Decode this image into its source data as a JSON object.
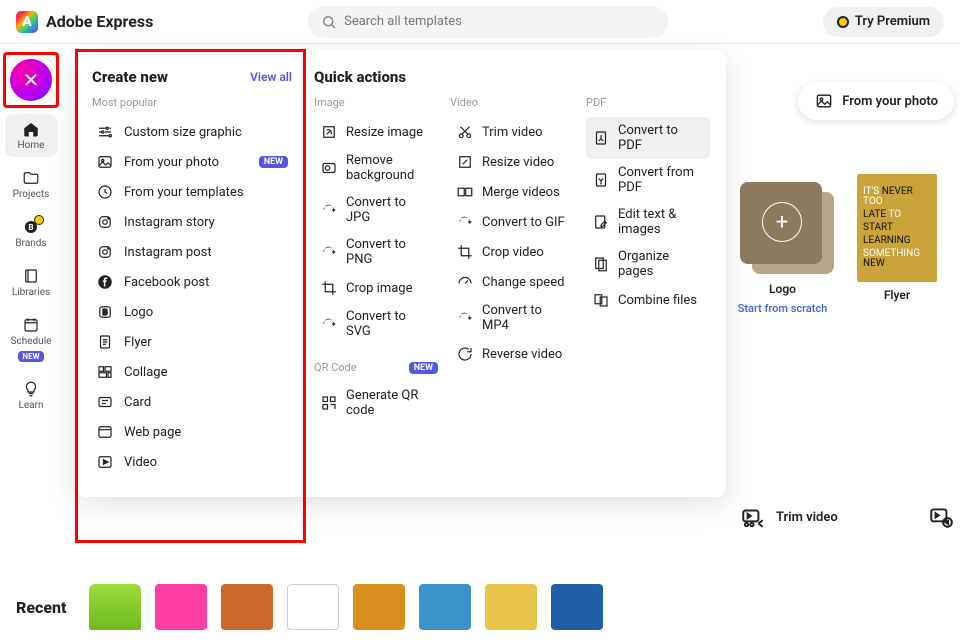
{
  "header": {
    "brand": "Adobe Express",
    "brand_glyph": "A",
    "search_placeholder": "Search all templates",
    "premium_label": "Try Premium"
  },
  "sidenav": {
    "items": [
      {
        "label": "Home",
        "icon": "home-icon"
      },
      {
        "label": "Projects",
        "icon": "folder-icon"
      },
      {
        "label": "Brands",
        "icon": "brand-icon"
      },
      {
        "label": "Libraries",
        "icon": "book-icon"
      },
      {
        "label": "Schedule",
        "icon": "calendar-icon",
        "badge": "NEW"
      },
      {
        "label": "Learn",
        "icon": "bulb-icon"
      }
    ]
  },
  "create_panel": {
    "title": "Create new",
    "view_all": "View all",
    "subhead": "Most popular",
    "items": [
      {
        "label": "Custom size graphic",
        "icon": "sliders-icon"
      },
      {
        "label": "From your photo",
        "icon": "photo-icon",
        "pill": "NEW"
      },
      {
        "label": "From your templates",
        "icon": "clock-icon"
      },
      {
        "label": "Instagram story",
        "icon": "instagram-icon"
      },
      {
        "label": "Instagram post",
        "icon": "instagram-icon"
      },
      {
        "label": "Facebook post",
        "icon": "facebook-icon"
      },
      {
        "label": "Logo",
        "icon": "bold-icon"
      },
      {
        "label": "Flyer",
        "icon": "page-icon"
      },
      {
        "label": "Collage",
        "icon": "collage-icon"
      },
      {
        "label": "Card",
        "icon": "card-icon"
      },
      {
        "label": "Web page",
        "icon": "browser-icon"
      },
      {
        "label": "Video",
        "icon": "play-icon"
      }
    ]
  },
  "quick_actions": {
    "title": "Quick actions",
    "columns": [
      {
        "head": "Image",
        "rows": [
          {
            "label": "Resize image",
            "icon": "resize-icon"
          },
          {
            "label": "Remove background",
            "icon": "cut-bg-icon"
          },
          {
            "label": "Convert to JPG",
            "icon": "convert-icon"
          },
          {
            "label": "Convert to PNG",
            "icon": "convert-icon"
          },
          {
            "label": "Crop image",
            "icon": "crop-icon"
          },
          {
            "label": "Convert to SVG",
            "icon": "convert-icon"
          }
        ],
        "qr_head": "QR Code",
        "qr_pill": "NEW",
        "qr_rows": [
          {
            "label": "Generate QR code",
            "icon": "qr-icon"
          }
        ]
      },
      {
        "head": "Video",
        "rows": [
          {
            "label": "Trim video",
            "icon": "trim-icon"
          },
          {
            "label": "Resize video",
            "icon": "resize-icon"
          },
          {
            "label": "Merge videos",
            "icon": "merge-icon"
          },
          {
            "label": "Convert to GIF",
            "icon": "convert-icon"
          },
          {
            "label": "Crop video",
            "icon": "crop-icon"
          },
          {
            "label": "Change speed",
            "icon": "speed-icon"
          },
          {
            "label": "Convert to MP4",
            "icon": "convert-icon"
          },
          {
            "label": "Reverse video",
            "icon": "reverse-icon"
          }
        ]
      },
      {
        "head": "PDF",
        "rows": [
          {
            "label": "Convert to PDF",
            "icon": "pdf-icon",
            "hover": true
          },
          {
            "label": "Convert from PDF",
            "icon": "pdf-out-icon"
          },
          {
            "label": "Edit text & images",
            "icon": "edit-doc-icon"
          },
          {
            "label": "Organize pages",
            "icon": "pages-icon"
          },
          {
            "label": "Combine files",
            "icon": "combine-icon"
          }
        ]
      }
    ]
  },
  "cards": {
    "logo": {
      "title": "Logo",
      "sub": "Start from scratch"
    },
    "flyer": {
      "title": "Flyer",
      "lines": [
        [
          "IT'S ",
          "NEVER",
          " TOO"
        ],
        [
          "LATE",
          " TO"
        ],
        [
          "START"
        ],
        [
          "LEARNING"
        ],
        [
          "SOMETHING ",
          "NEW"
        ]
      ]
    }
  },
  "quick_strip": {
    "from_photo": "From your photo",
    "trim_video": "Trim video"
  },
  "recent": {
    "title": "Recent"
  },
  "colors": {
    "accent": "#5258e4",
    "highlight": "#ff0000"
  }
}
